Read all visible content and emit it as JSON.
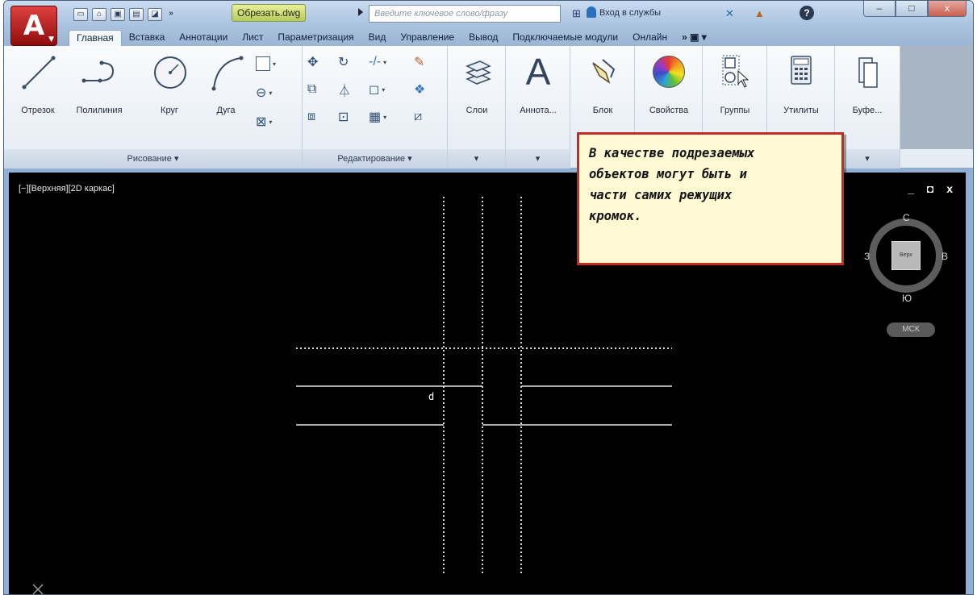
{
  "window": {
    "file_name": "Обрезать.dwg",
    "search_placeholder": "Введите ключевое слово/фразу",
    "login_label": "Вход в службы",
    "app_letter": "A",
    "help_label": "?",
    "controls": [
      "–",
      "□",
      "x"
    ]
  },
  "ribbon_tabs": [
    "Главная",
    "Вставка",
    "Аннотации",
    "Лист",
    "Параметризация",
    "Вид",
    "Управление",
    "Вывод",
    "Подключаемые модули",
    "Онлайн"
  ],
  "ribbon_tabs_extra": "»  ▣ ▾",
  "active_tab": "Главная",
  "draw_panel": {
    "tools": [
      "Отрезок",
      "Полилиния",
      "Круг",
      "Дуга"
    ],
    "footer": "Рисование ▾"
  },
  "modify_panel": {
    "footer": "Редактирование ▾"
  },
  "layers_panel": {
    "label": "Слои",
    "footer": "▾"
  },
  "annotation_panel": {
    "label": "Аннота...",
    "icon_letter": "A",
    "footer": "▾"
  },
  "block_panel": {
    "label": "Блок"
  },
  "properties_panel": {
    "label": "Свойства"
  },
  "groups_panel": {
    "label": "Группы"
  },
  "utilities_panel": {
    "label": "Утилиты"
  },
  "clipboard_panel": {
    "label": "Буфе...",
    "footer": "▾"
  },
  "viewport": {
    "label": "[−][Верхняя][2D каркас]",
    "controls": "_ ◘ x",
    "cursor_label": "d"
  },
  "viewcube": {
    "north": "С",
    "south": "Ю",
    "west": "З",
    "east": "В",
    "face": "Верх",
    "ucs": "МСК"
  },
  "callout": {
    "lines": [
      "В качестве подрезаемых",
      "объектов могут быть и",
      "части самих режущих",
      "кромок."
    ]
  },
  "colors": {
    "callout_border": "#c42b22",
    "callout_bg": "#fff9d4",
    "canvas_bg": "#000000",
    "ribbon_bg": "#f4f7fb"
  }
}
